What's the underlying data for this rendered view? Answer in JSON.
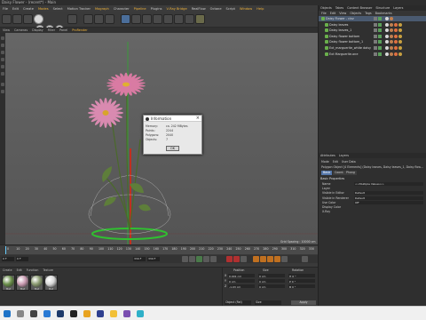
{
  "window": {
    "title": "Daisy Flower - (recent*) - Main"
  },
  "menu": [
    "File",
    "Edit",
    "Create",
    "Modes",
    "Select",
    "Motion Tracker",
    "Mograph",
    "Character",
    "Pipeline",
    "Plugins",
    "V-Ray Bridge",
    "RealFlow",
    "Octane",
    "Script",
    "Window",
    "Help"
  ],
  "menu_highlight": [
    "Modes",
    "Mograph",
    "Pipeline",
    "V-Ray Bridge",
    "Window",
    "Help"
  ],
  "toolbar_xyz": [
    "X",
    "Y",
    "Z"
  ],
  "viewport_menu": [
    "View",
    "Cameras",
    "Display",
    "Filter",
    "Panel",
    "ProRender"
  ],
  "viewport_menu_active": "ProRender",
  "viewport": {
    "grid_spacing": "Grid Spacing : 10000 cm"
  },
  "info_dialog": {
    "title": "Information",
    "rows": [
      {
        "label": "Memory:",
        "value": "ca. 242 MBytes"
      },
      {
        "label": "Points:",
        "value": "2244"
      },
      {
        "label": "Polygons:",
        "value": "2040"
      },
      {
        "label": "Objects:",
        "value": "7"
      }
    ],
    "ok_label": "OK"
  },
  "timeline": {
    "ticks": [
      "0",
      "10",
      "20",
      "30",
      "40",
      "50",
      "60",
      "70",
      "80",
      "90",
      "100",
      "110",
      "120",
      "130",
      "140",
      "150",
      "160",
      "170",
      "180",
      "190",
      "200",
      "210",
      "220",
      "230",
      "240",
      "250",
      "260",
      "270",
      "280",
      "290",
      "300",
      "310",
      "320",
      "330"
    ],
    "start": "0 F",
    "current": "0 F",
    "end": "330 F",
    "end2": "330 F"
  },
  "material_menu": [
    "Create",
    "Edit",
    "Function",
    "Texture"
  ],
  "materials": [
    {
      "name": "Mat",
      "color": "#6a8f4a"
    },
    {
      "name": "Mat",
      "color": "#c89ab0"
    },
    {
      "name": "Mat",
      "color": "#8a9a70"
    },
    {
      "name": "Mat",
      "color": "#d8d8d8"
    }
  ],
  "coordinates": {
    "headers": [
      "Position",
      "Size",
      "Rotation"
    ],
    "rows": [
      {
        "axis": "X",
        "pos": "0.001 cm",
        "size": "0 cm",
        "rot": "H 0 °"
      },
      {
        "axis": "Y",
        "pos": "0 cm",
        "size": "0 cm",
        "rot": "P 0 °"
      },
      {
        "axis": "Z",
        "pos": "-1.03 cm",
        "size": "0 cm",
        "rot": "B 0 °"
      }
    ],
    "mode_object": "Object (Rel)",
    "mode_size": "Size",
    "apply_label": "Apply"
  },
  "objects_tabs": [
    "Objects",
    "Takes",
    "Content Browser",
    "Structure",
    "Layers"
  ],
  "objects_menu": [
    "File",
    "Edit",
    "View",
    "Objects",
    "Tags",
    "Bookmarks"
  ],
  "objects": [
    {
      "name": "Daisy Flower - cinz",
      "selected": true,
      "indent": 0
    },
    {
      "name": "Daisy leaves",
      "selected": false,
      "indent": 1
    },
    {
      "name": "Daisy leaves_1",
      "selected": false,
      "indent": 1
    },
    {
      "name": "Daisy flower bottom",
      "selected": false,
      "indent": 1
    },
    {
      "name": "Daisy flower bottom_1",
      "selected": false,
      "indent": 1
    },
    {
      "name": "Ext_marguerite_white daisy",
      "selected": false,
      "indent": 1
    },
    {
      "name": "Ext Marguerite.one",
      "selected": false,
      "indent": 1
    }
  ],
  "attributes": {
    "tabs_top": [
      "Attributes",
      "Layers"
    ],
    "menu": [
      "Mode",
      "Edit",
      "User Data"
    ],
    "header": "Polygon Object [4 Elements] (Daisy leaves, Daisy leaves_1, Daisy flow...",
    "tabs": [
      "Basic",
      "Coord.",
      "Phong"
    ],
    "active_tab": "Basic",
    "section": "Basic Properties",
    "rows": [
      {
        "label": "Name",
        "value": "<<Multiple Values>>"
      },
      {
        "label": "Layer",
        "value": ""
      },
      {
        "label": "Visible in Editor",
        "value": "Default"
      },
      {
        "label": "Visible in Renderer",
        "value": "Default"
      },
      {
        "label": "Use Color",
        "value": "Off"
      },
      {
        "label": "Display Color",
        "value": ""
      },
      {
        "label": "X-Ray",
        "value": ""
      }
    ]
  },
  "taskbar_icons": [
    {
      "name": "start",
      "color": "#1e73c8"
    },
    {
      "name": "search",
      "color": "#888"
    },
    {
      "name": "task-view",
      "color": "#444"
    },
    {
      "name": "edge",
      "color": "#2a7ad4"
    },
    {
      "name": "photoshop",
      "color": "#1e3a6a"
    },
    {
      "name": "x-app",
      "color": "#222"
    },
    {
      "name": "chrome",
      "color": "#e8a320"
    },
    {
      "name": "cinema4d",
      "color": "#2e3f8f"
    },
    {
      "name": "explorer",
      "color": "#f2c037"
    },
    {
      "name": "app",
      "color": "#7a4fb0"
    },
    {
      "name": "app2",
      "color": "#2fb0c8"
    }
  ]
}
